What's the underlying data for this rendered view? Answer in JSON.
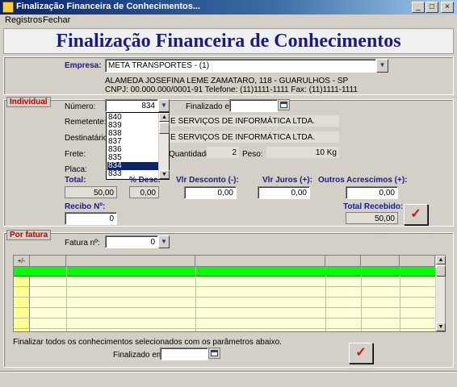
{
  "window": {
    "title": "Finalização Financeira de Conhecimentos...",
    "controls": [
      "_",
      "□",
      "×"
    ]
  },
  "menu": [
    "Registros",
    "Fechar"
  ],
  "heading": "Finalização Financeira de Conhecimentos",
  "empresa": {
    "label": "Empresa:",
    "value": "META TRANSPORTES - (1)",
    "address": "ALAMEDA JOSEFINA LEME ZAMATARO, 118 - GUARULHOS - SP",
    "cnpj": "CNPJ: 00.000.000/0001-91 Telefone: (11)1111-1111 Fax: (11)1111-1111"
  },
  "individual": {
    "group_label": "Individual",
    "numero_label": "Número:",
    "numero_value": "834",
    "finalizado_label": "Finalizado em:",
    "finalizado_value": "",
    "remetente_label": "Remetente:",
    "remetente_value": "E SERVIÇOS DE INFORMÁTICA LTDA.",
    "destinatario_label": "Destinatário:",
    "destinatario_value": "E SERVIÇOS DE INFORMÁTICA LTDA.",
    "frete_label": "Frete:",
    "quantidade_label": "Quantidade:",
    "quantidade_value": "2",
    "peso_label": "Peso:",
    "peso_value": "10 Kg",
    "placa_label": "Placa:",
    "dropdown_items": [
      "840",
      "839",
      "838",
      "837",
      "836",
      "835",
      "834",
      "833"
    ],
    "dropdown_selected": "834",
    "total_label": "Total:",
    "total_value": "50,00",
    "desc_pct_label": "% Desc.",
    "desc_pct_value": "0,00",
    "vlr_desconto_label": "Vlr Desconto (-):",
    "vlr_desconto_value": "0,00",
    "vlr_juros_label": "Vlr Juros (+):",
    "vlr_juros_value": "0,00",
    "outros_label": "Outros Acrescimos (+):",
    "outros_value": "0,00",
    "recibo_label": "Recibo Nº:",
    "recibo_value": "0",
    "total_recebido_label": "Total Recebido:",
    "total_recebido_value": "50,00",
    "confirm_glyph": "✓"
  },
  "por_fatura": {
    "group_label": "Por fatura",
    "fatura_label": "Fatura nº:",
    "fatura_value": "0",
    "grid_corner": "+/-",
    "footer_text": "Finalizar todos os conhecimentos selecionados com os parâmetros abaixo.",
    "finalizado_label": "Finalizado em:",
    "finalizado_value": "",
    "confirm_glyph": "✓"
  },
  "colors": {
    "title_bar": "#0a246a",
    "heading_text": "#1a1a8c",
    "group_label": "#c00000",
    "grid_selected_row": "#00ff00",
    "grid_rowheader": "#ffff90",
    "confirm_check": "#d01010"
  }
}
